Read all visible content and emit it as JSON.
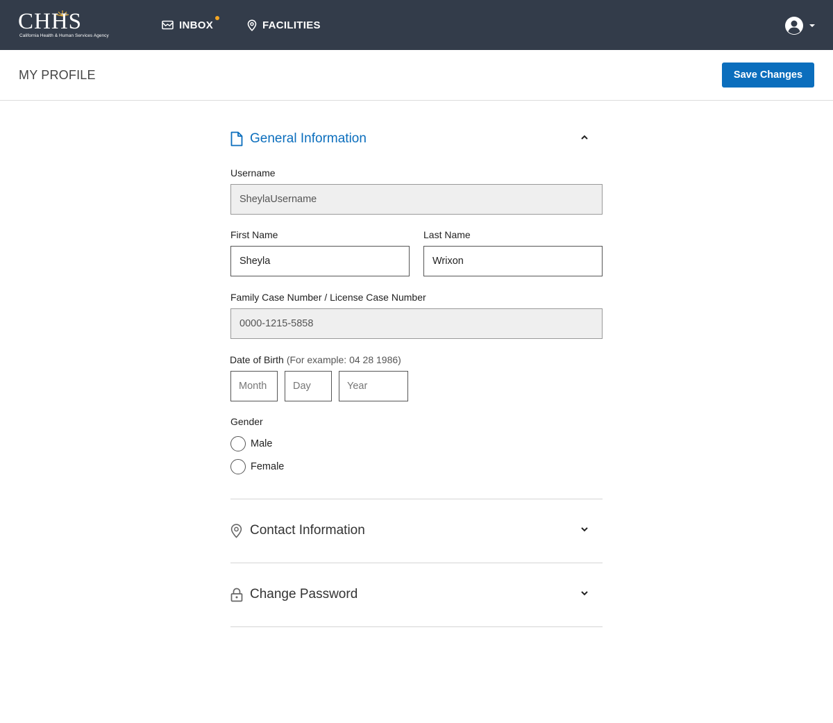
{
  "brand": {
    "logo_text": "CHHS",
    "logo_subtitle": "California Health & Human Services Agency"
  },
  "nav": {
    "items": [
      {
        "label": "INBOX",
        "icon": "inbox-icon",
        "has_notification": true
      },
      {
        "label": "FACILITIES",
        "icon": "location-pin-icon"
      }
    ],
    "user_icon": "user-avatar-icon"
  },
  "header": {
    "title": "MY PROFILE",
    "save_label": "Save Changes"
  },
  "general": {
    "title": "General Information",
    "icon": "document-icon",
    "expanded": true,
    "username": {
      "label": "Username",
      "value": "SheylaUsername"
    },
    "first_name": {
      "label": "First Name",
      "value": "Sheyla"
    },
    "last_name": {
      "label": "Last Name",
      "value": "Wrixon"
    },
    "case_number": {
      "label": "Family Case Number / License Case Number",
      "value": "0000-1215-5858"
    },
    "dob": {
      "label": "Date of Birth",
      "hint": "(For example: 04 28 1986)",
      "month_placeholder": "Month",
      "day_placeholder": "Day",
      "year_placeholder": "Year"
    },
    "gender": {
      "label": "Gender",
      "options": [
        "Male",
        "Female"
      ]
    }
  },
  "contact": {
    "title": "Contact Information",
    "icon": "location-pin-icon",
    "expanded": false
  },
  "password": {
    "title": "Change Password",
    "icon": "lock-icon",
    "expanded": false
  },
  "colors": {
    "nav_bg": "#333c4a",
    "accent": "#0b6ebd",
    "notification": "#f5a623"
  }
}
